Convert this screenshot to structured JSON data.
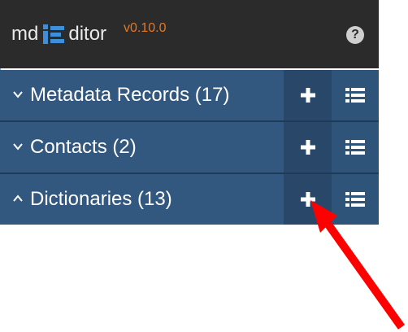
{
  "header": {
    "brand_md": "md",
    "brand_rest": "ditor",
    "version": "v0.10.0",
    "help_icon": "?",
    "colors": {
      "background": "#2b2b2b",
      "brand_icon": "#3f8fd8",
      "version": "#e8771f"
    }
  },
  "panels": [
    {
      "label": "Metadata Records (17)",
      "expanded": false,
      "chevron": "chevron-down-icon",
      "add_icon": "plus-icon",
      "list_icon": "list-icon"
    },
    {
      "label": "Contacts (2)",
      "expanded": false,
      "chevron": "chevron-down-icon",
      "add_icon": "plus-icon",
      "list_icon": "list-icon"
    },
    {
      "label": "Dictionaries (13)",
      "expanded": true,
      "chevron": "chevron-up-icon",
      "add_icon": "plus-icon",
      "list_icon": "list-icon"
    }
  ],
  "annotation": {
    "type": "arrow",
    "color": "#ff0000"
  },
  "colors": {
    "panel": "#33587f",
    "add_button": "#294869",
    "list_button": "#2f5479"
  }
}
